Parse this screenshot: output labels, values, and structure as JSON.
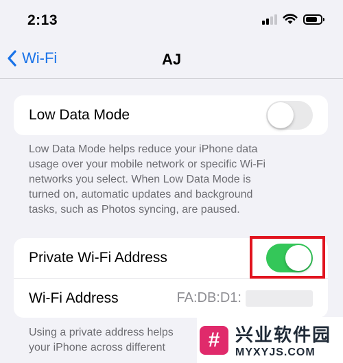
{
  "status_bar": {
    "time": "2:13",
    "signal_bars_on": 2,
    "signal_bars_total": 4
  },
  "nav": {
    "back_label": "Wi-Fi",
    "title": "AJ"
  },
  "low_data": {
    "label": "Low Data Mode",
    "state": "off",
    "footnote": "Low Data Mode helps reduce your iPhone data\nusage over your mobile network or specific Wi-Fi\nnetworks you select. When Low Data Mode is\nturned on, automatic updates and background\ntasks, such as Photos syncing, are paused."
  },
  "private_address": {
    "label": "Private Wi-Fi Address",
    "state": "on",
    "wifi_address_label": "Wi-Fi Address",
    "wifi_address_value": "FA:DB:D1:",
    "footnote": "Using a private address helps\nyour iPhone across different"
  },
  "watermark": {
    "logo_char": "#",
    "text_cn": "兴业软件园",
    "text_en": "MYXYJS.COM"
  },
  "colors": {
    "accent": "#1a73e8",
    "toggle_on": "#34c759",
    "toggle_off": "#e9e9ea",
    "highlight": "#e1141f"
  }
}
